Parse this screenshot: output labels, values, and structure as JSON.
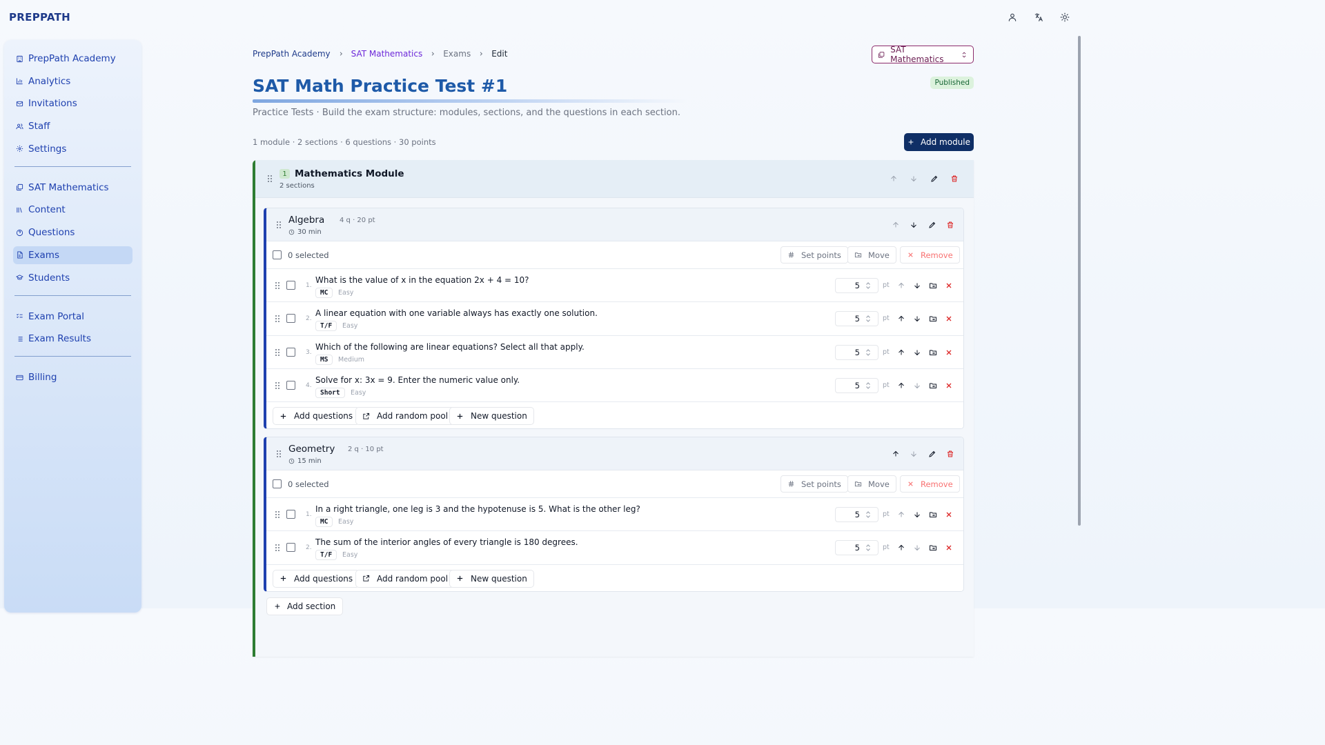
{
  "brand": "PREPPATH",
  "top_icons": [
    "user-icon",
    "translate-icon",
    "sun-icon"
  ],
  "sidebar": {
    "groups": [
      [
        {
          "label": "PrepPath Academy",
          "icon": "building-icon"
        },
        {
          "label": "Analytics",
          "icon": "bar-chart-icon"
        },
        {
          "label": "Invitations",
          "icon": "mail-icon"
        },
        {
          "label": "Staff",
          "icon": "users-icon"
        },
        {
          "label": "Settings",
          "icon": "gear-icon"
        }
      ],
      [
        {
          "label": "SAT Mathematics",
          "icon": "course-icon"
        },
        {
          "label": "Content",
          "icon": "library-icon"
        },
        {
          "label": "Questions",
          "icon": "question-circle-icon"
        },
        {
          "label": "Exams",
          "icon": "document-icon",
          "active": true
        },
        {
          "label": "Students",
          "icon": "graduation-cap-icon"
        }
      ],
      [
        {
          "label": "Exam Portal",
          "icon": "list-check-icon"
        },
        {
          "label": "Exam Results",
          "icon": "list-icon"
        }
      ],
      [
        {
          "label": "Billing",
          "icon": "credit-card-icon"
        }
      ]
    ]
  },
  "breadcrumb": [
    "PrepPath Academy",
    "SAT Mathematics",
    "Exams",
    "Edit"
  ],
  "course_select": {
    "label": "SAT Mathematics"
  },
  "page": {
    "title": "SAT Math Practice Test #1",
    "status": "Published",
    "subtitle": "Practice Tests · Build the exam structure: modules, sections, and the questions in each section.",
    "stats": "1 module · 2 sections · 6 questions · 30 points",
    "add_module": "Add module"
  },
  "module": {
    "number": "1",
    "title": "Mathematics Module",
    "sub": "2 sections",
    "add_section": "Add section"
  },
  "bulk": {
    "selected": "0 selected",
    "set_points": "Set points",
    "move": "Move",
    "remove": "Remove"
  },
  "footer_buttons": {
    "add_questions": "Add questions",
    "add_random_pool": "Add random pool",
    "new_question": "New question"
  },
  "pt_unit": "pt",
  "sections": [
    {
      "title": "Algebra",
      "meta": "4 q · 20 pt",
      "time": "30 min",
      "questions": [
        {
          "num": "1.",
          "text": "What is the value of x in the equation 2x + 4 = 10?",
          "type": "MC",
          "difficulty": "Easy",
          "points": "5"
        },
        {
          "num": "2.",
          "text": "A linear equation with one variable always has exactly one solution.",
          "type": "T/F",
          "difficulty": "Easy",
          "points": "5"
        },
        {
          "num": "3.",
          "text": "Which of the following are linear equations? Select all that apply.",
          "type": "MS",
          "difficulty": "Medium",
          "points": "5"
        },
        {
          "num": "4.",
          "text": "Solve for x: 3x = 9. Enter the numeric value only.",
          "type": "Short",
          "difficulty": "Easy",
          "points": "5"
        }
      ]
    },
    {
      "title": "Geometry",
      "meta": "2 q · 10 pt",
      "time": "15 min",
      "questions": [
        {
          "num": "1.",
          "text": "In a right triangle, one leg is 3 and the hypotenuse is 5. What is the other leg?",
          "type": "MC",
          "difficulty": "Easy",
          "points": "5"
        },
        {
          "num": "2.",
          "text": "The sum of the interior angles of every triangle is 180 degrees.",
          "type": "T/F",
          "difficulty": "Easy",
          "points": "5"
        }
      ]
    }
  ]
}
